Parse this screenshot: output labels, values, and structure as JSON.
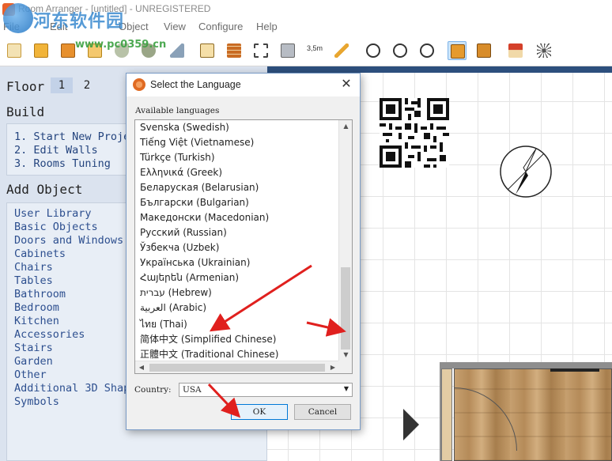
{
  "window": {
    "title": "Room Arranger - [untitled] - UNREGISTERED",
    "watermark": {
      "site_name": "河东软件园",
      "url": "www.pc0359.cn"
    }
  },
  "menu": {
    "items": [
      "File",
      "Edit",
      "Object",
      "View",
      "Configure",
      "Help"
    ]
  },
  "toolbar": {
    "buttons": [
      {
        "icon": "new-project-icon"
      },
      {
        "icon": "open-folder-icon"
      },
      {
        "icon": "save-icon"
      },
      {
        "icon": "print-icon"
      },
      {
        "icon": "undo-icon"
      },
      {
        "icon": "redo-icon"
      },
      {
        "icon": "brush-icon"
      },
      {
        "icon": "floor-plan-icon"
      },
      {
        "icon": "wall-icon"
      },
      {
        "icon": "select-corners-icon"
      },
      {
        "icon": "object-3d-icon"
      },
      {
        "icon": "measure-icon",
        "label": "3,5m"
      },
      {
        "icon": "pencil-icon"
      },
      {
        "icon": "zoom-fit-icon"
      },
      {
        "icon": "zoom-in-icon"
      },
      {
        "icon": "zoom-out-icon"
      },
      {
        "icon": "view-2d-icon",
        "selected": true
      },
      {
        "icon": "view-layers-icon"
      },
      {
        "icon": "house-3d-icon"
      },
      {
        "icon": "settings-wand-icon"
      }
    ]
  },
  "left_panel": {
    "floor_label": "Floor",
    "floors": [
      "1",
      "2"
    ],
    "active_floor": "1",
    "build_label": "Build",
    "build_steps": [
      "1. Start New Proje",
      "2. Edit Walls",
      "3. Rooms Tuning"
    ],
    "add_object_label": "Add Object",
    "object_categories": [
      "User Library",
      "Basic Objects",
      "Doors and Windows",
      "Cabinets",
      "Chairs",
      "Tables",
      "Bathroom",
      "Bedroom",
      "Kitchen",
      "Accessories",
      "Stairs",
      "Garden",
      "Other",
      "Additional 3D Shap",
      "Symbols"
    ]
  },
  "dialog": {
    "title": "Select the Language",
    "close_glyph": "✕",
    "available_label": "Available languages",
    "languages": [
      "Svenska (Swedish)",
      "Tiếng Việt (Vietnamese)",
      "Türkçe (Turkish)",
      "Ελληνικά (Greek)",
      "Беларуская (Belarusian)",
      "Български (Bulgarian)",
      "Македонски (Macedonian)",
      "Русский (Russian)",
      "Ўзбекча (Uzbek)",
      "Українська (Ukrainian)",
      "Հայերեն (Armenian)",
      "עברית (Hebrew)",
      "العربية (Arabic)",
      "ไทย (Thai)",
      "简体中文 (Simplified Chinese)",
      "正體中文 (Traditional Chinese)"
    ],
    "country_label": "Country:",
    "country_value": "USA",
    "ok_label": "OK",
    "cancel_label": "Cancel"
  },
  "colors": {
    "panel_bg": "#dbe3ef",
    "link_text": "#2d4f8f",
    "annotation_arrow": "#e0201e"
  }
}
